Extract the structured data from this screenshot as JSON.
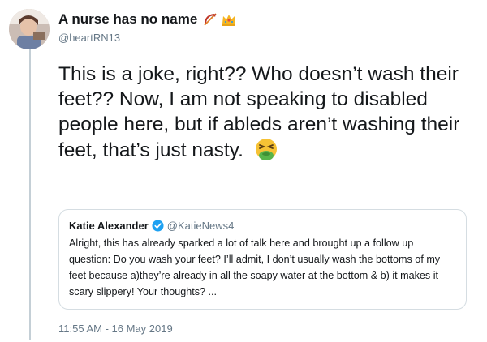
{
  "tweet": {
    "display_name": "A nurse has no name",
    "handle": "@heartRN13",
    "text": "This is a joke, right?? Who doesn’t wash their feet?? Now, I am not speaking to disabled people here, but if ableds aren’t washing their feet, that’s just nasty.",
    "name_emoji": [
      "bow-and-arrow-icon",
      "crown-icon"
    ],
    "text_emoji": "nauseated-face-icon",
    "timestamp": "11:55 AM - 16 May 2019"
  },
  "quote": {
    "display_name": "Katie Alexander",
    "verified": true,
    "handle": "@KatieNews4",
    "text": "Alright, this has already sparked a lot of talk here and brought up a follow up question: Do you wash your feet? I’ll admit, I don’t usually wash the bottoms of my feet because a)they’re already in all the soapy water at the bottom & b) it makes it scary slippery! Your thoughts? ..."
  },
  "colors": {
    "primary_text": "#14171a",
    "secondary_text": "#657786",
    "border": "#d5dde2",
    "verified_blue": "#1da1f2"
  }
}
